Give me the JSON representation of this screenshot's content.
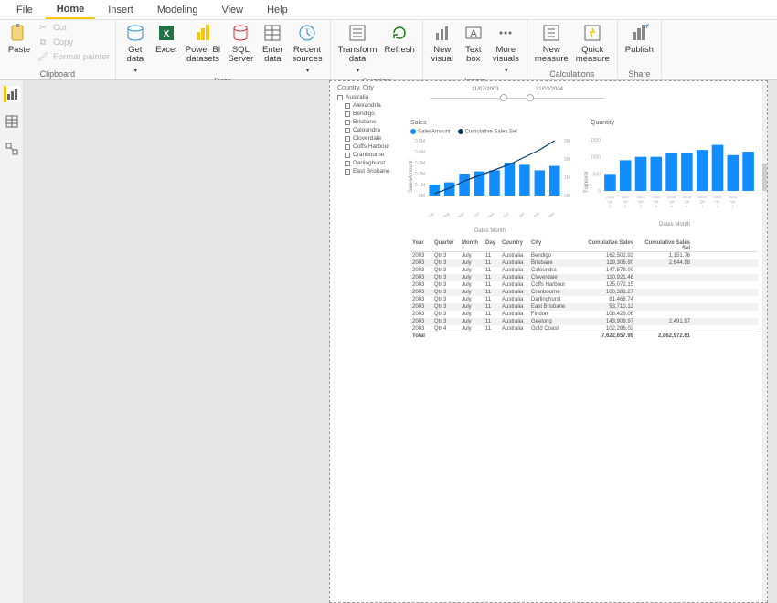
{
  "tabs": [
    "File",
    "Home",
    "Insert",
    "Modeling",
    "View",
    "Help"
  ],
  "active_tab": "Home",
  "ribbon": {
    "clipboard": {
      "paste": "Paste",
      "cut": "Cut",
      "copy": "Copy",
      "format_painter": "Format painter",
      "label": "Clipboard"
    },
    "data": {
      "get_data": "Get\ndata",
      "excel": "Excel",
      "pbi_ds": "Power BI\ndatasets",
      "sql": "SQL\nServer",
      "enter": "Enter\ndata",
      "recent": "Recent\nsources",
      "label": "Data"
    },
    "queries": {
      "transform": "Transform\ndata",
      "refresh": "Refresh",
      "label": "Queries"
    },
    "insert": {
      "new_visual": "New\nvisual",
      "text_box": "Text\nbox",
      "more_visuals": "More\nvisuals",
      "label": "Insert"
    },
    "calculations": {
      "new_measure": "New\nmeasure",
      "quick_measure": "Quick\nmeasure",
      "label": "Calculations"
    },
    "share": {
      "publish": "Publish",
      "label": "Share"
    }
  },
  "slicer": {
    "header": "Country, City",
    "items": [
      "Australia",
      "Alexandria",
      "Bendigo",
      "Brisbane",
      "Caloundra",
      "Cloverdale",
      "Coffs Harbour",
      "Cranbourne",
      "Darlinghurst",
      "East Brisbane"
    ]
  },
  "date_slicer": {
    "from": "11/07/2003",
    "to": "31/03/2004"
  },
  "sales_chart": {
    "title": "Sales",
    "legend": [
      "SalesAmount",
      "Cumulative Sales Sel"
    ],
    "ylabel": "SalesAmount",
    "xlabel": "Dates Month"
  },
  "qty_chart": {
    "title": "Quantity",
    "ylabel": "Turnover",
    "xlabel": "Dates Month"
  },
  "table": {
    "headers": [
      "Year",
      "Quarter",
      "Month",
      "Day",
      "Country",
      "City",
      "Cumulative Sales",
      "Cumulative Sales Sel"
    ],
    "rows": [
      [
        "2003",
        "Qtr 3",
        "July",
        "11",
        "Australia",
        "Bendigo",
        "162,502.92",
        "1,151.76"
      ],
      [
        "2003",
        "Qtr 3",
        "July",
        "11",
        "Australia",
        "Brisbane",
        "119,306.90",
        "2,644.98"
      ],
      [
        "2003",
        "Qtr 3",
        "July",
        "11",
        "Australia",
        "Caloundra",
        "147,578.00",
        ""
      ],
      [
        "2003",
        "Qtr 3",
        "July",
        "11",
        "Australia",
        "Cloverdale",
        "110,921.46",
        ""
      ],
      [
        "2003",
        "Qtr 3",
        "July",
        "11",
        "Australia",
        "Coffs Harbour",
        "125,072.15",
        ""
      ],
      [
        "2003",
        "Qtr 3",
        "July",
        "11",
        "Australia",
        "Cranbourne",
        "100,381.27",
        ""
      ],
      [
        "2003",
        "Qtr 3",
        "July",
        "11",
        "Australia",
        "Darlinghurst",
        "81,468.74",
        ""
      ],
      [
        "2003",
        "Qtr 3",
        "July",
        "11",
        "Australia",
        "East Brisbane",
        "93,710.12",
        ""
      ],
      [
        "2003",
        "Qtr 3",
        "July",
        "11",
        "Australia",
        "Findon",
        "108,428.06",
        ""
      ],
      [
        "2003",
        "Qtr 3",
        "July",
        "11",
        "Australia",
        "Geelong",
        "143,909.97",
        "2,491.97"
      ],
      [
        "2003",
        "Qtr 4",
        "July",
        "11",
        "Australia",
        "Gold Coast",
        "102,286.02",
        ""
      ]
    ],
    "total_label": "Total",
    "totals": [
      "7,622,657.99",
      "2,862,972.61"
    ]
  },
  "chart_data": [
    {
      "type": "bar+line",
      "title": "Sales",
      "xlabel": "Dates Month",
      "ylabel": "SalesAmount",
      "categories": [
        "2003 Qtr 3 July",
        "2003 Qtr 3 Aug",
        "2003 Qtr 3 Sept",
        "2003 Qtr 4 Oct",
        "2003 Qtr 4 Nov",
        "2003 Qtr 4 Dec",
        "2004 Qtr 1 Jan",
        "2004 Qtr 1 Feb",
        "2004 Qtr 1 Mar"
      ],
      "series": [
        {
          "name": "SalesAmount",
          "type": "bar",
          "values": [
            0.1,
            0.12,
            0.2,
            0.22,
            0.23,
            0.3,
            0.28,
            0.23,
            0.27
          ]
        },
        {
          "name": "Cumulative Sales Sel",
          "type": "line",
          "values": [
            0.1,
            0.4,
            0.8,
            1.1,
            1.4,
            1.7,
            2.1,
            2.5,
            3.0
          ]
        }
      ],
      "ylim_left": [
        0,
        0.5
      ],
      "ylim_right": [
        0,
        3
      ],
      "left_unit": "M",
      "right_unit": "M"
    },
    {
      "type": "bar",
      "title": "Quantity",
      "xlabel": "Dates Month",
      "ylabel": "Turnover",
      "categories": [
        "2003 Qtr 3 July",
        "2003 Qtr 3 Aug",
        "2003 Qtr 3 Sept",
        "2003 Qtr 4 Oct",
        "2003 Qtr 4 Nov",
        "2003 Qtr 4 Dec",
        "2004 Qtr 1 Jan",
        "2004 Qtr 1 Feb",
        "2004 Qtr 1 Mar"
      ],
      "values": [
        500,
        900,
        1000,
        1000,
        1100,
        1100,
        1200,
        1350,
        1050,
        1150
      ],
      "ylim": [
        0,
        1500
      ]
    }
  ]
}
